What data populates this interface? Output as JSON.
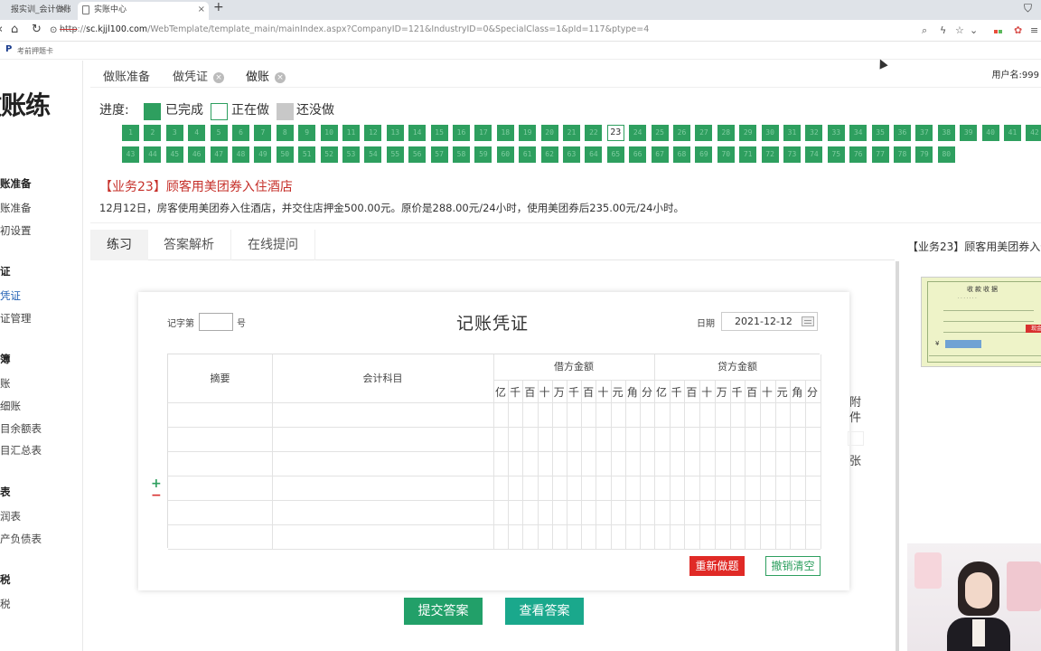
{
  "browser": {
    "tabs": [
      {
        "label": "报实训_会计做账实"
      },
      {
        "label": "实账中心"
      }
    ],
    "new_tab": "+",
    "url": {
      "secure_text": "http",
      "host": "sc.kjjl100.com",
      "path": "/WebTemplate/template_main/mainIndex.aspx?CompanyID=121&IndustryID=0&SpecialClass=1&pId=117&ptype=4"
    },
    "bookmark": "考前押题卡"
  },
  "sidebar": {
    "logo": "做账练",
    "groups": [
      {
        "label": "账准备",
        "items": [
          {
            "label": "账准备"
          },
          {
            "label": "初设置"
          }
        ]
      },
      {
        "label": "证",
        "items": [
          {
            "label": "凭证",
            "active": true
          },
          {
            "label": "证管理"
          }
        ]
      },
      {
        "label": "簿",
        "items": [
          {
            "label": "账"
          },
          {
            "label": "细账"
          },
          {
            "label": "目余额表"
          },
          {
            "label": "目汇总表"
          }
        ]
      },
      {
        "label": "表",
        "items": [
          {
            "label": "润表"
          },
          {
            "label": "产负债表"
          }
        ]
      },
      {
        "label": "税",
        "items": [
          {
            "label": "税"
          }
        ]
      }
    ]
  },
  "page_tabs": [
    {
      "label": "做账准备",
      "closable": false
    },
    {
      "label": "做凭证",
      "closable": true
    },
    {
      "label": "做账",
      "closable": true,
      "active": true
    }
  ],
  "username": "用户名:999",
  "progress": {
    "label": "进度:",
    "legend": [
      {
        "label": "已完成",
        "color": "#2e9f5f"
      },
      {
        "label": "正在做",
        "color": "#ffffff"
      },
      {
        "label": "还没做",
        "color": "#c8c8c8"
      }
    ],
    "current": 23,
    "total": 80
  },
  "task": {
    "title": "【业务23】顾客用美团券入住酒店",
    "description": "12月12日，房客使用美团券入住酒店，并交住店押金500.00元。原价是288.00元/24小时，使用美团券后235.00元/24小时。"
  },
  "sub_tabs": [
    {
      "label": "练习",
      "active": true
    },
    {
      "label": "答案解析"
    },
    {
      "label": "在线提问"
    }
  ],
  "reference_title": "【业务23】顾客用美团券入住",
  "voucher": {
    "number_label": "记字第",
    "number_value": "",
    "number_suffix": "号",
    "title": "记账凭证",
    "date_label": "日期",
    "date_value": "2021-12-12",
    "columns": {
      "summary": "摘要",
      "account": "会计科目",
      "debit": "借方金额",
      "credit": "贷方金额",
      "digits": [
        "亿",
        "千",
        "百",
        "十",
        "万",
        "千",
        "百",
        "十",
        "元",
        "角",
        "分"
      ]
    },
    "attachment_label": "附件",
    "attachment_unit": "张",
    "add_row": "+",
    "remove_row": "−",
    "redo_button": "重新做题",
    "clear_button": "撤销清空"
  },
  "actions": {
    "submit": "提交答案",
    "view": "查看答案"
  },
  "receipt_thumb": {
    "title": "收款收据",
    "amount": "¥",
    "stamp": "现金"
  }
}
